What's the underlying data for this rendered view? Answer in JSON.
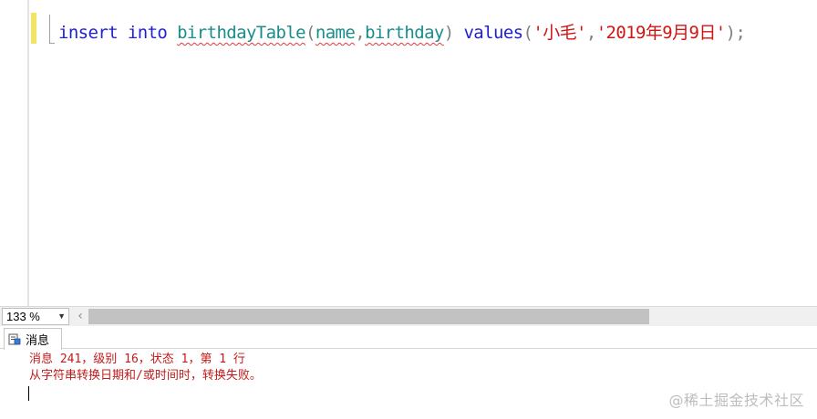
{
  "editor": {
    "code_tokens": [
      {
        "text": "insert",
        "cls": "kw"
      },
      {
        "text": " ",
        "cls": ""
      },
      {
        "text": "into",
        "cls": "kw"
      },
      {
        "text": " ",
        "cls": ""
      },
      {
        "text": "birthdayTable",
        "cls": "obj"
      },
      {
        "text": "(",
        "cls": "punct"
      },
      {
        "text": "name",
        "cls": "obj"
      },
      {
        "text": ",",
        "cls": "punct"
      },
      {
        "text": "birthday",
        "cls": "obj"
      },
      {
        "text": ")",
        "cls": "punct"
      },
      {
        "text": " ",
        "cls": ""
      },
      {
        "text": "values",
        "cls": "kw"
      },
      {
        "text": "(",
        "cls": "punct"
      },
      {
        "text": "'小毛'",
        "cls": "str"
      },
      {
        "text": ",",
        "cls": "punct"
      },
      {
        "text": "'2019年9月9日'",
        "cls": "str"
      },
      {
        "text": ");",
        "cls": "punct"
      }
    ],
    "colors": {
      "keyword": "#1f1fd2",
      "object": "#1a8c8c",
      "string": "#d11414",
      "punctuation": "#808080",
      "error_squiggle": "#e03b3b"
    }
  },
  "status": {
    "zoom_value": "133 %",
    "scroll_left_glyph": "‹"
  },
  "results": {
    "tab_label": "消息",
    "messages": [
      "消息 241，级别 16，状态 1，第 1 行",
      "从字符串转换日期和/或时间时，转换失败。"
    ],
    "message_color": "#c41a1a"
  },
  "watermark": "@稀土掘金技术社区"
}
